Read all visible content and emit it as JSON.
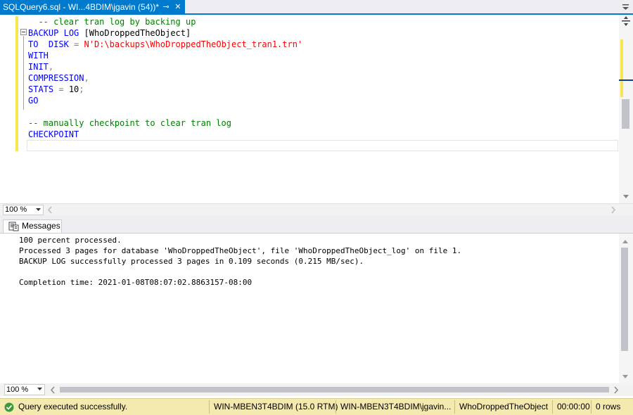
{
  "tab": {
    "title": "SQLQuery6.sql - WI...4BDIM\\jgavin (54))*",
    "pin_glyph": "⊸",
    "close_glyph": "✕"
  },
  "editor": {
    "lines": [
      [
        {
          "t": "  -- clear tran log by backing up",
          "c": "cm"
        }
      ],
      [
        {
          "t": "BACKUP",
          "c": "kw"
        },
        {
          "t": " ",
          "c": "tx"
        },
        {
          "t": "LOG",
          "c": "kw"
        },
        {
          "t": " [WhoDroppedTheObject]",
          "c": "tx"
        }
      ],
      [
        {
          "t": "TO",
          "c": "kw"
        },
        {
          "t": "  ",
          "c": "tx"
        },
        {
          "t": "DISK",
          "c": "kw"
        },
        {
          "t": " ",
          "c": "tx"
        },
        {
          "t": "=",
          "c": "op"
        },
        {
          "t": " ",
          "c": "tx"
        },
        {
          "t": "N'D:\\backups\\WhoDroppedTheObject_tran1.trn'",
          "c": "st"
        }
      ],
      [
        {
          "t": "WITH",
          "c": "kw"
        }
      ],
      [
        {
          "t": "INIT",
          "c": "kw"
        },
        {
          "t": ",",
          "c": "op"
        }
      ],
      [
        {
          "t": "COMPRESSION",
          "c": "kw"
        },
        {
          "t": ",",
          "c": "op"
        }
      ],
      [
        {
          "t": "STATS",
          "c": "kw"
        },
        {
          "t": " ",
          "c": "tx"
        },
        {
          "t": "=",
          "c": "op"
        },
        {
          "t": " 10",
          "c": "tx"
        },
        {
          "t": ";",
          "c": "op"
        }
      ],
      [
        {
          "t": "GO",
          "c": "kw"
        }
      ],
      [
        {
          "t": "",
          "c": "tx"
        }
      ],
      [
        {
          "t": "-- manually checkpoint to clear tran log",
          "c": "cm"
        }
      ],
      [
        {
          "t": "CHECKPOINT",
          "c": "kw"
        }
      ],
      [
        {
          "t": "",
          "c": "tx"
        }
      ]
    ],
    "zoom": "100 %"
  },
  "results": {
    "tab_label": "Messages",
    "messages": [
      "100 percent processed.",
      "Processed 3 pages for database 'WhoDroppedTheObject', file 'WhoDroppedTheObject_log' on file 1.",
      "BACKUP LOG successfully processed 3 pages in 0.109 seconds (0.215 MB/sec).",
      "",
      "Completion time: 2021-01-08T08:07:02.8863157-08:00"
    ],
    "zoom": "100 %"
  },
  "status": {
    "message": "Query executed successfully.",
    "server": "WIN-MBEN3T4BDIM (15.0 RTM)",
    "user": "WIN-MBEN3T4BDIM\\jgavin...",
    "database": "WhoDroppedTheObject",
    "elapsed": "00:00:00",
    "rows": "0 rows"
  },
  "colors": {
    "accent": "#007acc",
    "status_bar": "#f4eab0",
    "change_marker": "#f7e64f",
    "keyword": "#0000ff",
    "comment": "#008000",
    "string": "#ff0000",
    "success": "#3c9a3c"
  },
  "icons": {
    "tab_pin": "pin-icon",
    "tab_close": "close-icon",
    "tab_overflow": "chevron-down-icon",
    "editor_split": "split-icon",
    "messages": "messages-icon",
    "status": "check-circle-icon"
  }
}
